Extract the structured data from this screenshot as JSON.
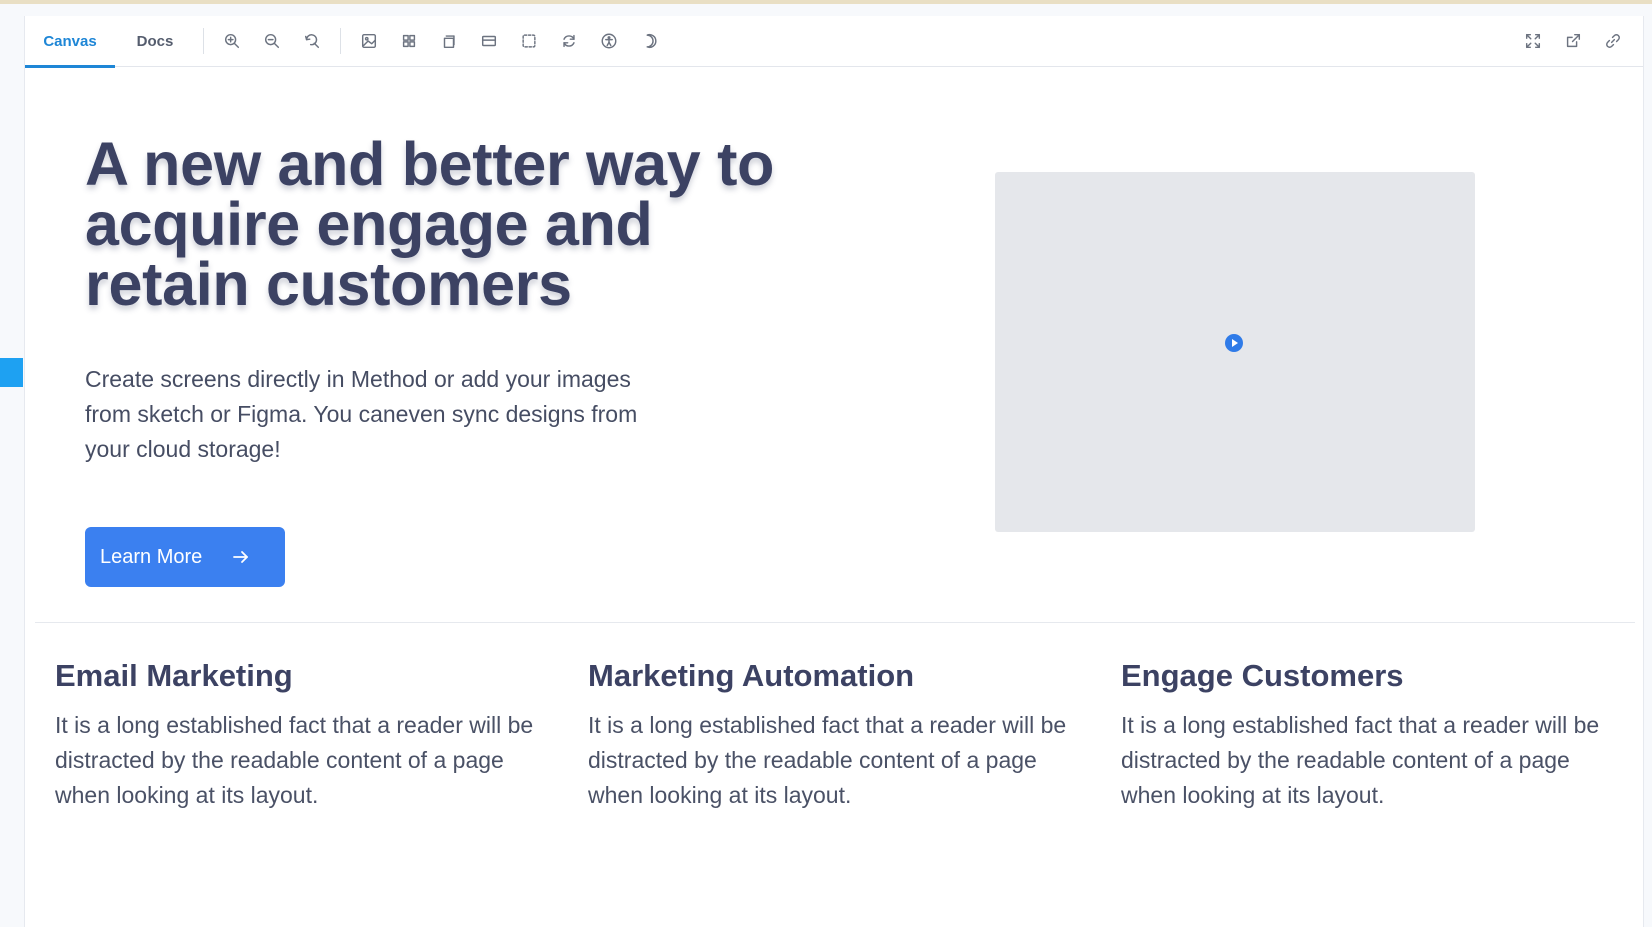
{
  "tabs": [
    {
      "label": "Canvas",
      "active": true
    },
    {
      "label": "Docs",
      "active": false
    }
  ],
  "toolbar_icons": [
    "zoom-in-icon",
    "zoom-out-icon",
    "zoom-reset-icon",
    "image-icon",
    "grid-icon",
    "layers-icon",
    "card-icon",
    "outline-icon",
    "refresh-icon",
    "accessibility-icon",
    "dark-mode-icon"
  ],
  "right_icons": [
    "fullscreen-icon",
    "open-new-tab-icon",
    "link-icon"
  ],
  "hero": {
    "title": "A new and better way to acquire engage and retain customers",
    "description": "Create screens directly in Method or add your images from sketch or Figma. You caneven sync designs from your cloud storage!",
    "button_label": "Learn More"
  },
  "features": [
    {
      "title": "Email Marketing",
      "text": "It is a long established fact that a reader will be distracted by the readable content of a page when looking at its layout."
    },
    {
      "title": "Marketing Automation",
      "text": "It is a long established fact that a reader will be distracted by the readable content of a page when looking at its layout."
    },
    {
      "title": "Engage Customers",
      "text": "It is a long established fact that a reader will be distracted by the readable content of a page when looking at its layout."
    }
  ],
  "colors": {
    "accent": "#1e86d6",
    "button": "#3b80f0",
    "heading": "#3c4263",
    "media_placeholder": "#e5e7eb"
  }
}
